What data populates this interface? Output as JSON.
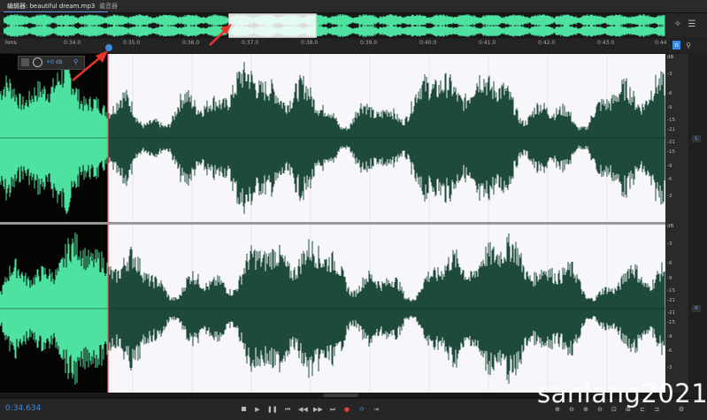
{
  "tabs": {
    "editor_label": "编辑器: beautiful dream.mp3",
    "editor_menu": "≡",
    "mixer_label": "混音器"
  },
  "ruler": {
    "unit_label": "hms",
    "ticks": [
      "0:34.0",
      "0:35.0",
      "0:36.0",
      "0:37.0",
      "0:38.0",
      "0:39.0",
      "0:40.0",
      "0:41.0",
      "0:42.0",
      "0:43.0",
      "0:44"
    ]
  },
  "clip_toolbar": {
    "gain_value": "+0 dB"
  },
  "db_scale": {
    "unit": "dB",
    "labels": [
      "-3",
      "-6",
      "-9",
      "-15",
      "-21",
      "-21",
      "-15",
      "-9",
      "-6",
      "-3"
    ]
  },
  "channels": {
    "left_badge": "L",
    "right_badge": "R"
  },
  "transport": {
    "timecode": "0:34.634",
    "buttons": [
      "stop",
      "play",
      "pause",
      "go-to-start",
      "rewind",
      "fast-forward",
      "go-to-end",
      "record",
      "loop",
      "skip-selection"
    ]
  },
  "watermark": "sanlang2021",
  "colors": {
    "waveform_selected": "#4ee2a0",
    "waveform_dark": "#1e4a3a",
    "playhead": "#e85a5a",
    "accent": "#3b8be0"
  }
}
